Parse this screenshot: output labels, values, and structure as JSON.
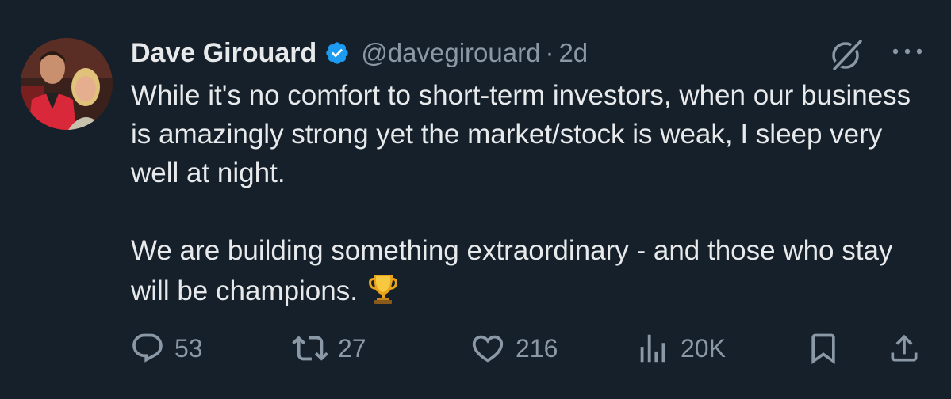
{
  "author": {
    "display_name": "Dave Girouard",
    "handle": "@davegirouard",
    "separator": "·",
    "time": "2d",
    "verified": true
  },
  "tweet": {
    "paragraphs": [
      "While it's no comfort to short-term investors, when our business is amazingly strong yet the market/stock is weak, I sleep very well at night.",
      "We are building something extraordinary - and those who stay will be champions."
    ],
    "emoji": "trophy-icon"
  },
  "actions": {
    "replies": "53",
    "reposts": "27",
    "likes": "216",
    "views": "20K"
  },
  "colors": {
    "background": "#15202b",
    "text": "#e7e9ea",
    "muted": "#8b98a5",
    "verified": "#1d9bf0"
  }
}
